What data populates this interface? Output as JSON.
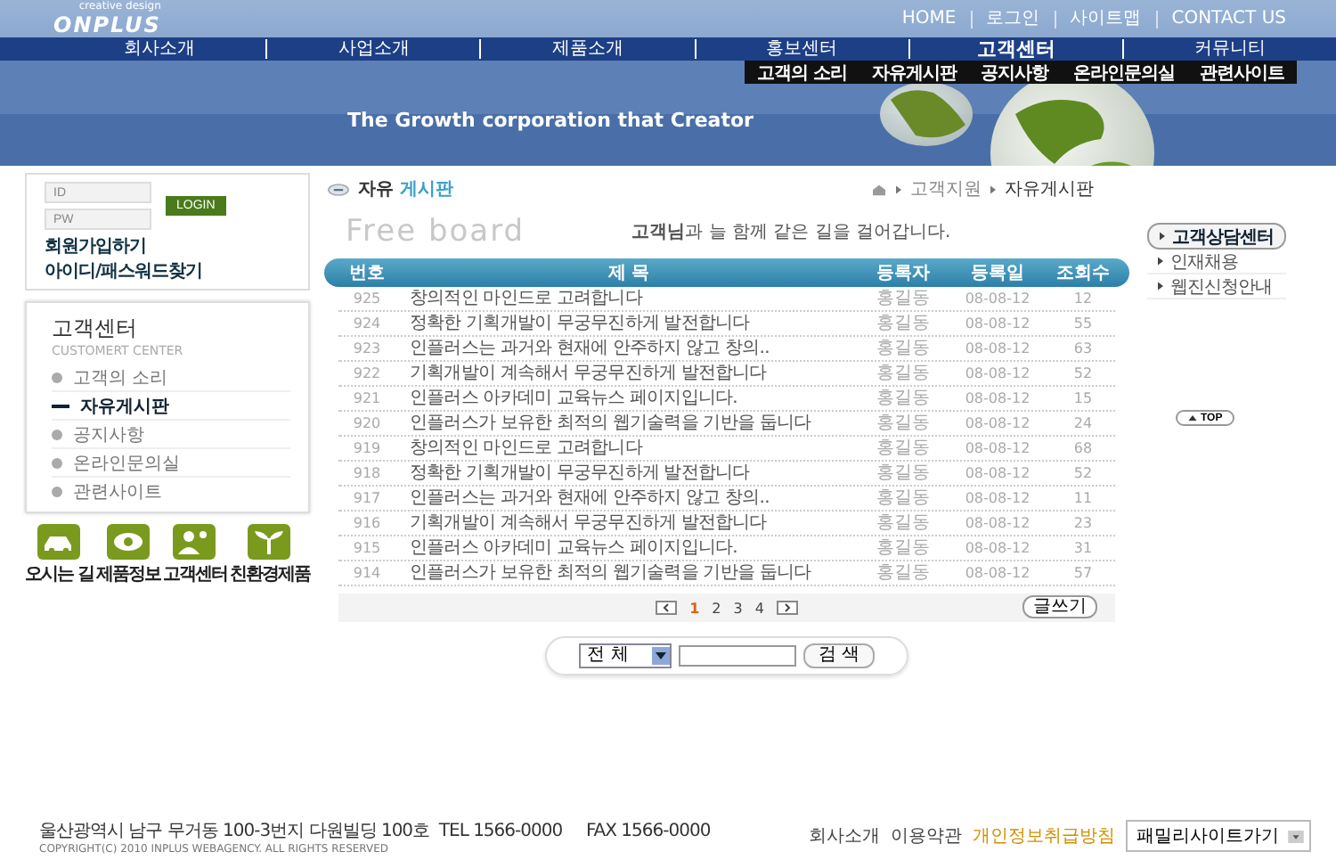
{
  "header": {
    "logo": "ONPLUS",
    "logo_tagline": "creative design",
    "top_links": [
      "HOME",
      "로그인",
      "사이트맵",
      "CONTACT US"
    ],
    "nav": [
      {
        "label": "회사소개",
        "selected": false
      },
      {
        "label": "사업소개",
        "selected": false
      },
      {
        "label": "제품소개",
        "selected": false
      },
      {
        "label": "홍보센터",
        "selected": false
      },
      {
        "label": "고객센터",
        "selected": true
      },
      {
        "label": "커뮤니티",
        "selected": false
      }
    ],
    "submenu": [
      "고객의 소리",
      "자유게시판",
      "공지사항",
      "온라인문의실",
      "관련사이트"
    ],
    "banner": {
      "kind": "picture",
      "headline": "The Growth corporation that Creator"
    }
  },
  "login": {
    "id_placeholder": "ID",
    "pw_placeholder": "PW",
    "button": "LOGIN",
    "links": [
      "회원가입하기",
      "아이디/패스워드찾기"
    ]
  },
  "side_menu": {
    "title": "고객센터",
    "subtitle": "CUSTOMERT CENTER",
    "items": [
      {
        "label": "고객의 소리",
        "selected": false
      },
      {
        "label": "자유게시판",
        "selected": true
      },
      {
        "label": "공지사항",
        "selected": false
      },
      {
        "label": "온라인문의실",
        "selected": false
      },
      {
        "label": "관련사이트",
        "selected": false
      }
    ]
  },
  "quick_links": [
    {
      "kind": "car",
      "label": "오시는 길"
    },
    {
      "kind": "eye",
      "label": "제품정보"
    },
    {
      "kind": "person",
      "label": "고객센터"
    },
    {
      "kind": "plant",
      "label": "친환경제품"
    }
  ],
  "board": {
    "title_plain": "자유",
    "title_accent": "게시판",
    "breadcrumb": [
      "고객지원",
      "자유게시판"
    ],
    "heading": "Free board",
    "slogan": "**고객님**과 늘 함께 같은 길을 걸어갑니다.",
    "columns": [
      "번호",
      "제 목",
      "등록자",
      "등록일",
      "조회수"
    ],
    "rows": [
      [
        "925",
        "창의적인 마인드로 고려합니다",
        "홍길동",
        "08-08-12",
        "12"
      ],
      [
        "924",
        "정확한 기획개발이 무궁무진하게 발전합니다",
        "홍길동",
        "08-08-12",
        "55"
      ],
      [
        "923",
        "인플러스는 과거와 현재에 안주하지 않고 창의..",
        "홍길동",
        "08-08-12",
        "63"
      ],
      [
        "922",
        "기획개발이 계속해서 무궁무진하게 발전합니다",
        "홍길동",
        "08-08-12",
        "52"
      ],
      [
        "921",
        "인플러스 아카데미 교육뉴스 페이지입니다.",
        "홍길동",
        "08-08-12",
        "15"
      ],
      [
        "920",
        "인플러스가 보유한 최적의 웹기술력을 기반을 둡니다",
        "홍길동",
        "08-08-12",
        "24"
      ],
      [
        "919",
        "창의적인 마인드로 고려합니다",
        "홍길동",
        "08-08-12",
        "68"
      ],
      [
        "918",
        "정확한 기획개발이 무궁무진하게 발전합니다",
        "홍길동",
        "08-08-12",
        "52"
      ],
      [
        "917",
        "인플러스는 과거와 현재에 안주하지 않고 창의..",
        "홍길동",
        "08-08-12",
        "11"
      ],
      [
        "916",
        "기획개발이 계속해서 무궁무진하게 발전합니다",
        "홍길동",
        "08-08-12",
        "23"
      ],
      [
        "915",
        "인플러스 아카데미 교육뉴스 페이지입니다.",
        "홍길동",
        "08-08-12",
        "31"
      ],
      [
        "914",
        "인플러스가 보유한 최적의 웹기술력을 기반을 둡니다",
        "홍길동",
        "08-08-12",
        "57"
      ]
    ],
    "pages": [
      {
        "label": "1",
        "selected": true
      },
      {
        "label": "2",
        "selected": false
      },
      {
        "label": "3",
        "selected": false
      },
      {
        "label": "4",
        "selected": false
      }
    ],
    "write_button": "글쓰기",
    "search_scope": "전 체",
    "search_button": "검 색"
  },
  "right_menu": [
    {
      "label": "고객상담센터",
      "selected": true
    },
    {
      "label": "인재채용",
      "selected": false
    },
    {
      "label": "웹진신청안내",
      "selected": false
    }
  ],
  "top_button": "TOP",
  "footer": {
    "address": "울산광역시 남구 무거동 100-3번지 다원빌딩 100호  TEL 1566-0000     FAX 1566-0000",
    "copyright": "COPYRIGHT(C) 2010 INPLUS WEBAGENCY. ALL RIGHTS RESERVED",
    "links": [
      {
        "label": "회사소개",
        "highlight": false
      },
      {
        "label": "이용약관",
        "highlight": false
      },
      {
        "label": "개인정보취급방침",
        "highlight": true
      }
    ],
    "family_site": "패밀리사이트가기"
  }
}
